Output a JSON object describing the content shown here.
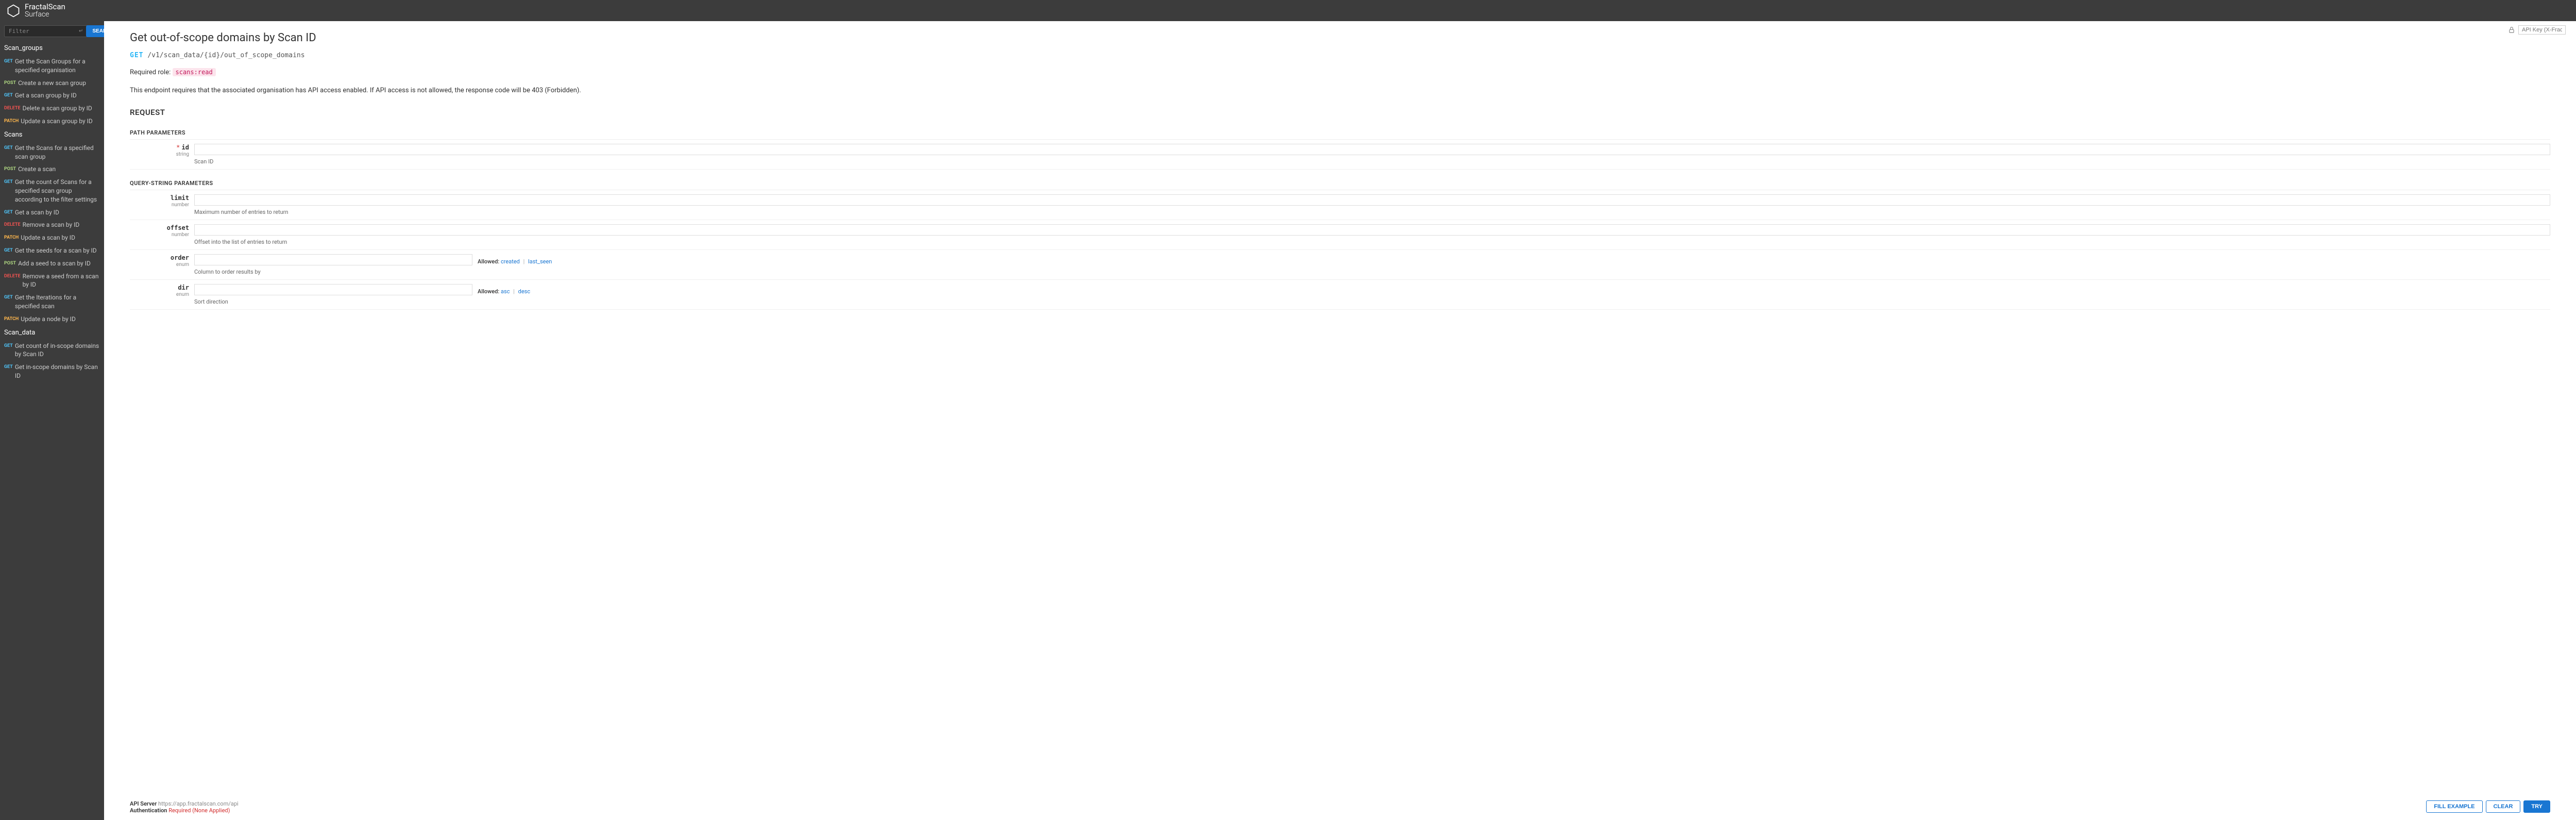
{
  "brand": {
    "line1": "FractalScan",
    "line2": "Surface"
  },
  "sidebar": {
    "filter_placeholder": "Filter",
    "search_label": "SEARCH",
    "sections": [
      {
        "title": "Scan_groups",
        "items": [
          {
            "method": "GET",
            "label": "Get the Scan Groups for a specified organisation"
          },
          {
            "method": "POST",
            "label": "Create a new scan group"
          },
          {
            "method": "GET",
            "label": "Get a scan group by ID"
          },
          {
            "method": "DELETE",
            "label": "Delete a scan group by ID"
          },
          {
            "method": "PATCH",
            "label": "Update a scan group by ID"
          }
        ]
      },
      {
        "title": "Scans",
        "items": [
          {
            "method": "GET",
            "label": "Get the Scans for a specified scan group"
          },
          {
            "method": "POST",
            "label": "Create a scan"
          },
          {
            "method": "GET",
            "label": "Get the count of Scans for a specified scan group according to the filter settings"
          },
          {
            "method": "GET",
            "label": "Get a scan by ID"
          },
          {
            "method": "DELETE",
            "label": "Remove a scan by ID"
          },
          {
            "method": "PATCH",
            "label": "Update a scan by ID"
          },
          {
            "method": "GET",
            "label": "Get the seeds for a scan by ID"
          },
          {
            "method": "POST",
            "label": "Add a seed to a scan by ID"
          },
          {
            "method": "DELETE",
            "label": "Remove a seed from a scan by ID"
          },
          {
            "method": "GET",
            "label": "Get the Iterations for a specified scan"
          },
          {
            "method": "PATCH",
            "label": "Update a node by ID"
          }
        ]
      },
      {
        "title": "Scan_data",
        "items": [
          {
            "method": "GET",
            "label": "Get count of in-scope domains by Scan ID"
          },
          {
            "method": "GET",
            "label": "Get in-scope domains by Scan ID"
          }
        ]
      }
    ]
  },
  "api_key_placeholder": "API Key (X-FractalScan-A...",
  "page": {
    "title": "Get out-of-scope domains by Scan ID",
    "method": "GET",
    "path": "/v1/scan_data/{id}/out_of_scope_domains",
    "role_label": "Required role:",
    "role_value": "scans:read",
    "description": "This endpoint requires that the associated organisation has API access enabled. If API access is not allowed, the response code will be 403 (Forbidden).",
    "request_heading": "REQUEST",
    "path_params_heading": "PATH PARAMETERS",
    "query_params_heading": "QUERY-STRING PARAMETERS",
    "params": {
      "id": {
        "name": "id",
        "type": "string",
        "required": "*",
        "desc": "Scan ID"
      },
      "limit": {
        "name": "limit",
        "type": "number",
        "desc": "Maximum number of entries to return"
      },
      "offset": {
        "name": "offset",
        "type": "number",
        "desc": "Offset into the list of entries to return"
      },
      "order": {
        "name": "order",
        "type": "enum",
        "desc": "Column to order results by",
        "allowed_label": "Allowed:",
        "allowed": [
          "created",
          "last_seen"
        ]
      },
      "dir": {
        "name": "dir",
        "type": "enum",
        "desc": "Sort direction",
        "allowed_label": "Allowed:",
        "allowed": [
          "asc",
          "desc"
        ]
      }
    }
  },
  "footer": {
    "api_server_label": "API Server",
    "api_server_value": "https://app.fractalscan.com/api",
    "auth_label": "Authentication",
    "auth_required": "Required",
    "auth_none": "(None Applied)",
    "fill_example": "FILL EXAMPLE",
    "clear": "CLEAR",
    "try": "TRY"
  }
}
